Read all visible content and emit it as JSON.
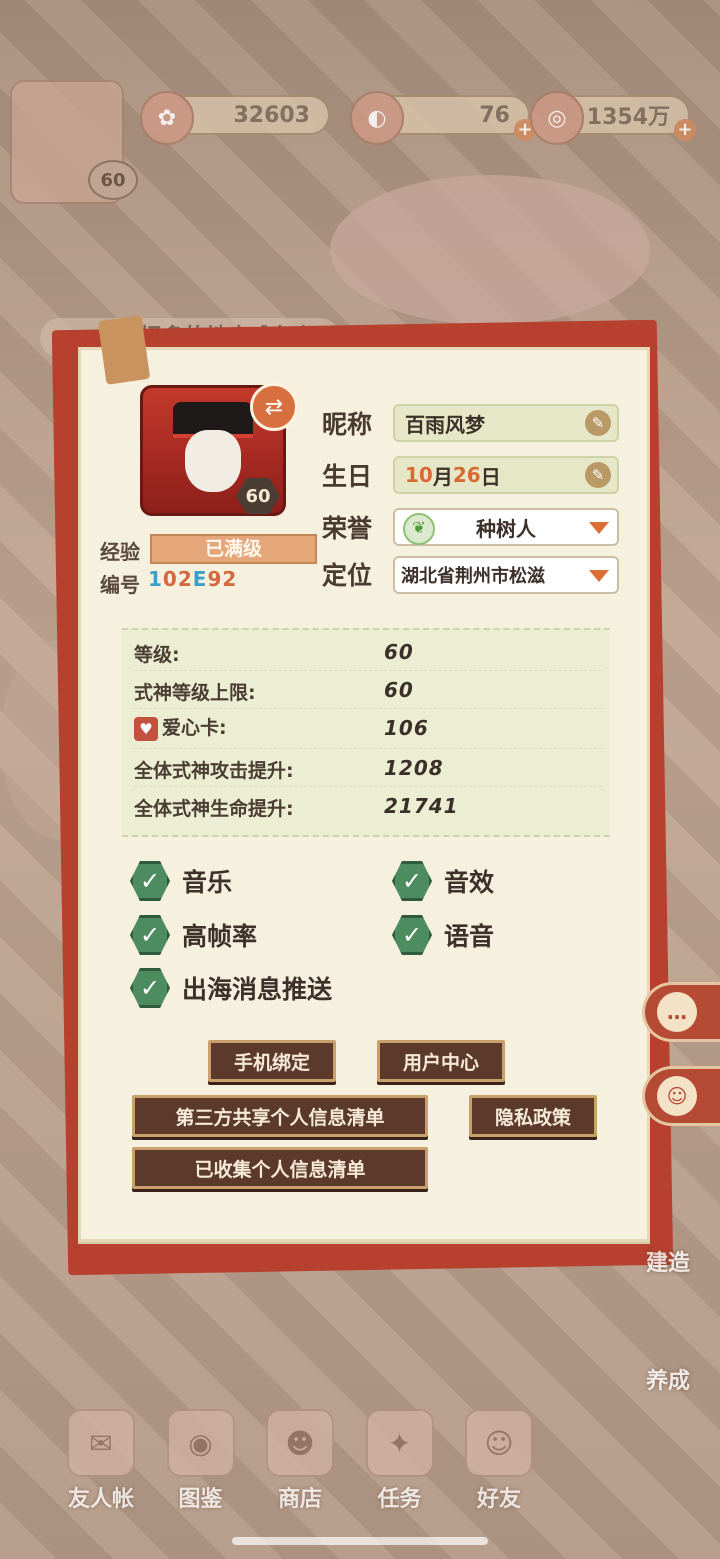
{
  "resources": [
    {
      "icon": "sakura-icon",
      "value": "32603"
    },
    {
      "icon": "magatama-icon",
      "value": "76"
    },
    {
      "icon": "coin-icon",
      "value": "1354万"
    }
  ],
  "top_level": "60",
  "marquee": "择多的地方难免有",
  "profile": {
    "level_badge": "60",
    "exp_label": "经验",
    "exp_value": "已满级",
    "id_label": "编号",
    "id_chars": [
      "1",
      "0",
      "2",
      "E",
      "9",
      "2"
    ],
    "nickname_label": "昵称",
    "nickname": "百雨风梦",
    "birthday_label": "生日",
    "birthday_month": "10",
    "birthday_month_unit": "月",
    "birthday_day": "26",
    "birthday_day_unit": "日",
    "honor_label": "荣誉",
    "honor_value": "种树人",
    "location_label": "定位",
    "location_value": "湖北省荆州市松滋"
  },
  "stats": [
    {
      "label": "等级:",
      "value": "60"
    },
    {
      "label": "式神等级上限:",
      "value": "60"
    },
    {
      "label": "爱心卡:",
      "value": "106"
    },
    {
      "label": "全体式神攻击提升:",
      "value": "1208"
    },
    {
      "label": "全体式神生命提升:",
      "value": "21741"
    }
  ],
  "toggles": [
    {
      "label": "音乐",
      "checked": true
    },
    {
      "label": "音效",
      "checked": true
    },
    {
      "label": "高帧率",
      "checked": true
    },
    {
      "label": "语音",
      "checked": true
    },
    {
      "label": "出海消息推送",
      "checked": true
    }
  ],
  "buttons": {
    "phone_bind": "手机绑定",
    "user_center": "用户中心",
    "third_party": "第三方共享个人信息清单",
    "privacy": "隐私政策",
    "collected": "已收集个人信息清单"
  },
  "side": {
    "build": "建造",
    "develop": "养成"
  },
  "nav": [
    "友人帐",
    "图鉴",
    "商店",
    "任务",
    "好友"
  ]
}
